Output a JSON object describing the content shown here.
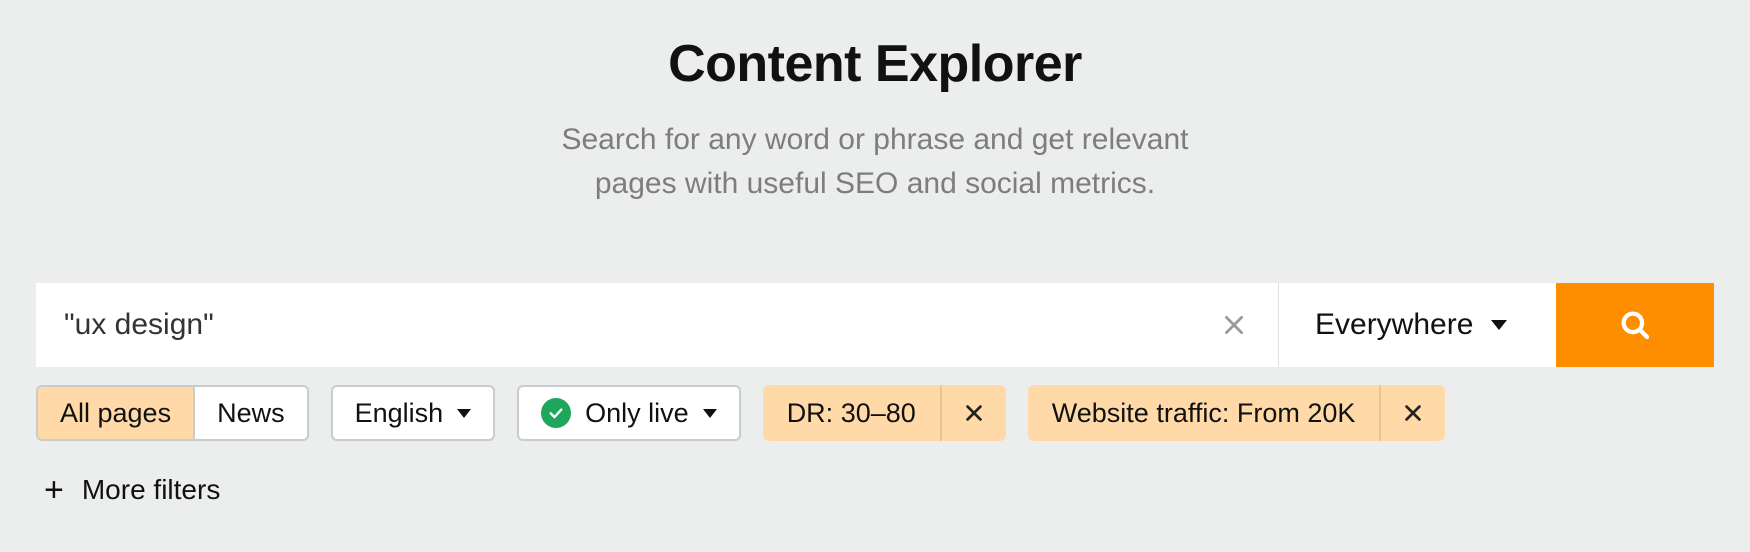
{
  "header": {
    "title": "Content Explorer",
    "subtitle_line1": "Search for any word or phrase and get relevant",
    "subtitle_line2": "pages with useful SEO and social metrics."
  },
  "search": {
    "value": "\"ux design\"",
    "scope_label": "Everywhere"
  },
  "filters": {
    "tabs": {
      "all_label": "All pages",
      "news_label": "News"
    },
    "language_label": "English",
    "live_label": "Only live",
    "chips": [
      {
        "label": "DR: 30–80"
      },
      {
        "label": "Website traffic: From 20K"
      }
    ],
    "more_label": "More filters"
  },
  "colors": {
    "accent": "#ff8d00",
    "chip_bg": "#ffdaa8",
    "success": "#1ea65a"
  }
}
